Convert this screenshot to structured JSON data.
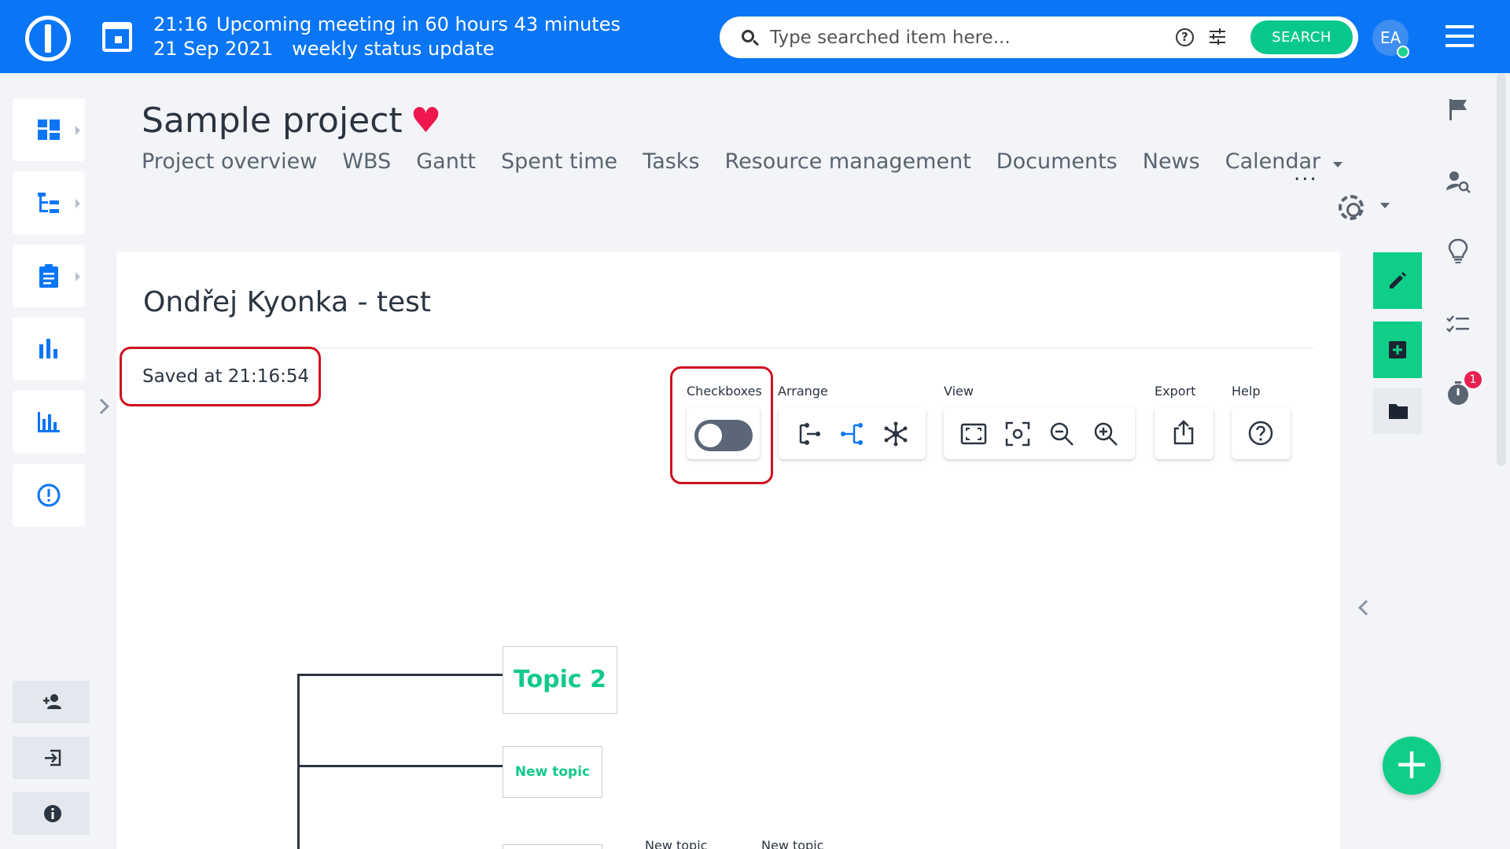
{
  "topbar": {
    "time": "21:16",
    "meeting_text": "Upcoming meeting in 60 hours 43 minutes",
    "date": "21 Sep 2021",
    "meeting_name": "weekly status update",
    "search_placeholder": "Type searched item here...",
    "search_button": "SEARCH",
    "avatar_initials": "EA"
  },
  "project": {
    "title": "Sample project",
    "heart": "♥",
    "tabs": [
      "Project overview",
      "WBS",
      "Gantt",
      "Spent time",
      "Tasks",
      "Resource management",
      "Documents",
      "News",
      "Calendar"
    ],
    "more": "..."
  },
  "mindmap": {
    "title": "Ondřej Kyonka - test",
    "saved_status": "Saved at 21:16:54",
    "toolbar": {
      "checkboxes_label": "Checkboxes",
      "checkboxes_on": false,
      "arrange_label": "Arrange",
      "view_label": "View",
      "export_label": "Export",
      "help_label": "Help"
    },
    "nodes": {
      "topic2": "Topic 2",
      "new_topic": "New topic",
      "new_topic_a": "New topic",
      "new_topic_b": "New topic"
    }
  },
  "right_rail": {
    "timer_badge": "1",
    "fab": "+"
  },
  "colors": {
    "brand_blue": "#0a76f6",
    "accent_green": "#0fce88",
    "heart_red": "#f0174f",
    "highlight_red": "#d0101f"
  }
}
